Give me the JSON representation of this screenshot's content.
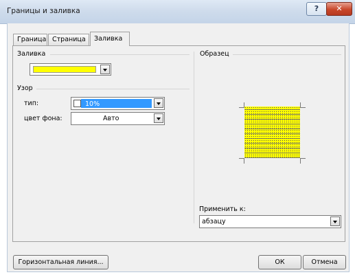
{
  "window": {
    "title": "Границы и заливка",
    "help_glyph": "?",
    "close_glyph": "✕"
  },
  "tabs": [
    {
      "label": "Граница",
      "active": false
    },
    {
      "label": "Страница",
      "active": false
    },
    {
      "label": "Заливка",
      "active": true
    }
  ],
  "fill": {
    "group_label": "Заливка",
    "color": "#ffff00"
  },
  "pattern": {
    "group_label": "Узор",
    "type_label": "тип:",
    "type_value": "10%",
    "bgcolor_label": "цвет фона:",
    "bgcolor_value": "Авто"
  },
  "preview": {
    "group_label": "Образец"
  },
  "apply": {
    "label": "Применить к:",
    "value": "абзацу"
  },
  "buttons": {
    "horizontal_line": "Горизонтальная линия...",
    "ok": "ОК",
    "cancel": "Отмена"
  }
}
